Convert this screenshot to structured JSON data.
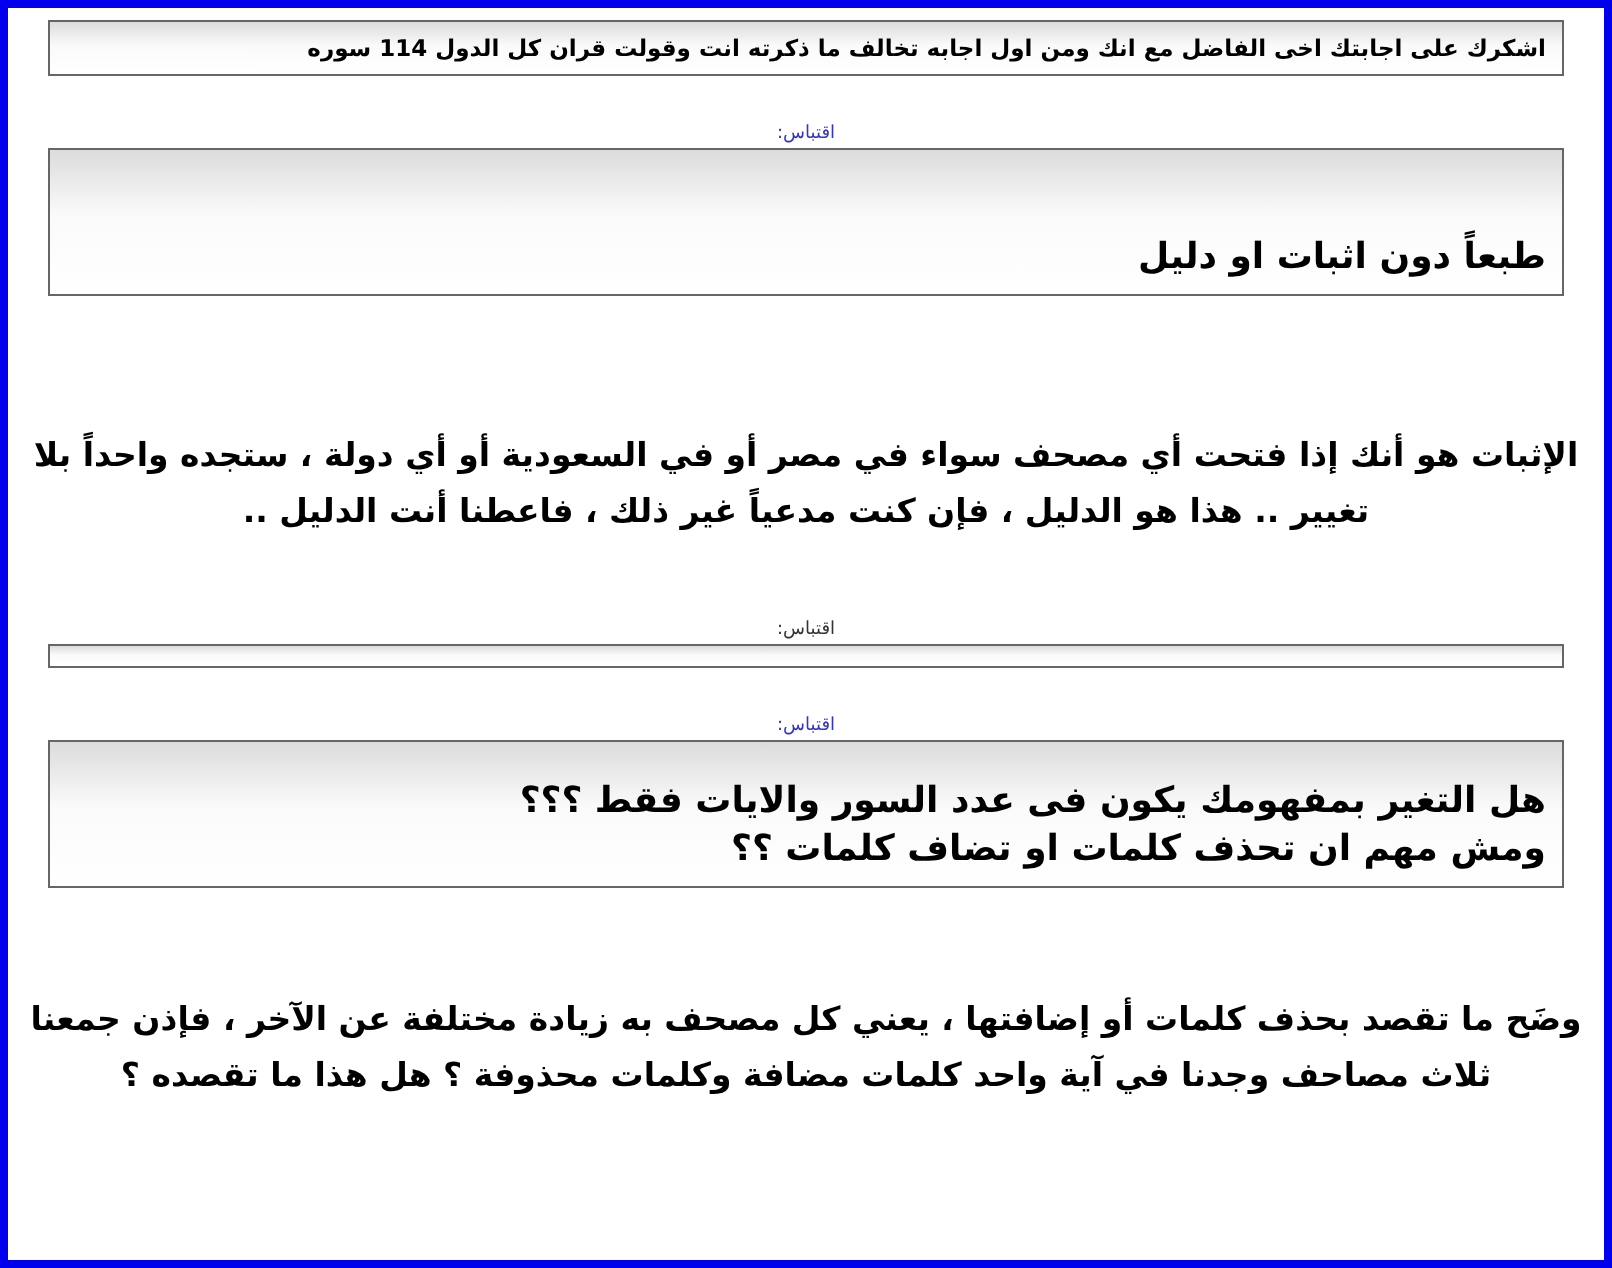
{
  "blocks": [
    {
      "kind": "note",
      "lines": [
        "اشكرك على اجابتك اخى الفاضل مع انك ومن اول اجابه تخالف ما ذكرته انت وقولت قران كل الدول 114 سوره"
      ]
    },
    {
      "kind": "quote",
      "label": "اقتباس:",
      "color": "#3333cc",
      "lines": [
        "طبعاً دون اثبات او دليل"
      ]
    },
    {
      "kind": "paragraph",
      "lines": [
        "الإثبات هو أنك إذا فتحت أي مصحف سواء في مصر أو في السعودية أو أي دولة ، ستجده واحداً بلا تغيير .. هذا هو الدليل ، فإن كنت مدعياً غير ذلك ، فاعطنا أنت الدليل .."
      ]
    },
    {
      "kind": "stub",
      "label": "اقتباس:",
      "color": "#333333"
    },
    {
      "kind": "quote",
      "label": "اقتباس:",
      "color": "#3333cc",
      "lines": [
        "هل التغير بمفهومك يكون فى عدد السور والايات فقط ؟؟؟",
        "ومش مهم ان تحذف كلمات او تضاف كلمات ؟؟"
      ]
    },
    {
      "kind": "paragraph",
      "lines": [
        "وضَح ما تقصد بحذف كلمات أو إضافتها ، يعني كل مصحف به زيادة مختلفة عن الآخر ، فإذن جمعنا ثلاث مصاحف وجدنا في آية واحد كلمات مضافة وكلمات محذوفة ؟ هل هذا ما تقصده ؟"
      ]
    }
  ]
}
